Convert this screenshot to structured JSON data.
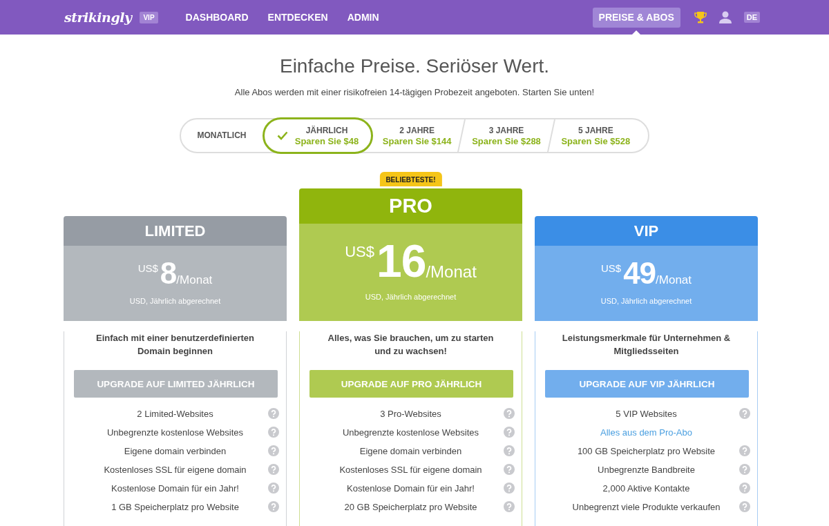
{
  "nav": {
    "logo": "strikingly",
    "logo_badge": "VIP",
    "links": [
      {
        "label": "DASHBOARD"
      },
      {
        "label": "ENTDECKEN"
      },
      {
        "label": "ADMIN"
      }
    ],
    "pricing_link": {
      "label": "PREISE & ABOS",
      "selected": true
    },
    "language": "DE"
  },
  "heading": {
    "title": "Einfache Preise. Seriöser Wert.",
    "subtitle": "Alle Abos werden mit einer risikofreien 14-tägigen Probezeit angeboten. Starten Sie unten!"
  },
  "billing_options": [
    {
      "label": "MONATLICH",
      "selected": false
    },
    {
      "label": "JÄHRLICH",
      "savings": "Sparen Sie $48",
      "selected": true
    },
    {
      "label": "2 JAHRE",
      "savings": "Sparen Sie $144",
      "selected": false
    },
    {
      "label": "3 JAHRE",
      "savings": "Sparen Sie $288",
      "selected": false
    },
    {
      "label": "5 JAHRE",
      "savings": "Sparen Sie $528",
      "selected": false
    }
  ],
  "plans": [
    {
      "name": "LIMITED",
      "color": "#969ca4",
      "featured": false,
      "currency": "US$",
      "amount": "8",
      "period": "/Monat",
      "billing": "USD, Jährlich abgerechnet",
      "description": "Einfach mit einer benutzerdefinierten Domain beginnen",
      "button": "UPGRADE AUF LIMITED JÄHRLICH",
      "features": [
        {
          "kind": "feature",
          "text": "2 Limited-Websites"
        },
        {
          "kind": "feature",
          "text": "Unbegrenzte kostenlose Websites"
        },
        {
          "kind": "feature",
          "text": "Eigene domain verbinden"
        },
        {
          "kind": "feature",
          "text": "Kostenloses SSL für eigene domain"
        },
        {
          "kind": "feature",
          "text": "Kostenlose Domain für ein Jahr!"
        },
        {
          "kind": "feature",
          "text": "1 GB Speicherplatz pro Website"
        }
      ]
    },
    {
      "name": "PRO",
      "color": "#90b50d",
      "featured": true,
      "badge": "BELIEBTESTE!",
      "currency": "US$",
      "amount": "16",
      "period": "/Monat",
      "billing": "USD, Jährlich abgerechnet",
      "description": "Alles, was Sie brauchen, um zu starten und zu wachsen!",
      "button": "UPGRADE AUF PRO JÄHRLICH",
      "features": [
        {
          "kind": "feature",
          "text": "3 Pro-Websites"
        },
        {
          "kind": "feature",
          "text": "Unbegrenzte kostenlose Websites"
        },
        {
          "kind": "feature",
          "text": "Eigene domain verbinden"
        },
        {
          "kind": "feature",
          "text": "Kostenloses SSL für eigene domain"
        },
        {
          "kind": "feature",
          "text": "Kostenlose Domain für ein Jahr!"
        },
        {
          "kind": "feature",
          "text": "20 GB Speicherplatz pro Website"
        }
      ]
    },
    {
      "name": "VIP",
      "color": "#3b8ee6",
      "featured": false,
      "currency": "US$",
      "amount": "49",
      "period": "/Monat",
      "billing": "USD, Jährlich abgerechnet",
      "description": "Leistungsmerkmale für Unternehmen & Mitgliedsseiten",
      "button": "UPGRADE AUF VIP JÄHRLICH",
      "features": [
        {
          "kind": "feature",
          "text": "5 VIP Websites"
        },
        {
          "kind": "link",
          "text": "Alles aus dem Pro-Abo"
        },
        {
          "kind": "feature",
          "text": "100 GB Speicherplatz pro Website"
        },
        {
          "kind": "feature",
          "text": "Unbegrenzte Bandbreite"
        },
        {
          "kind": "feature",
          "text": "2,000 Aktive Kontakte"
        },
        {
          "kind": "feature",
          "text": "Unbegrenzt viele Produkte verkaufen"
        }
      ]
    }
  ]
}
